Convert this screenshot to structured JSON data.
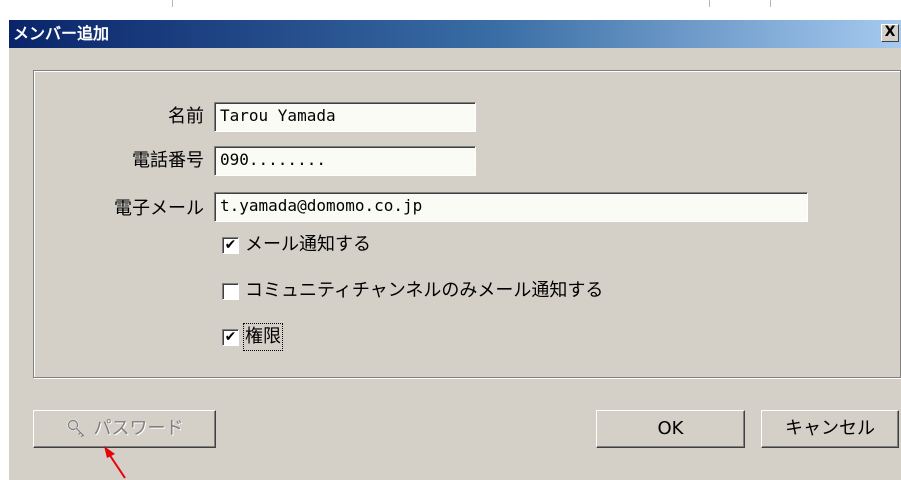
{
  "dialog": {
    "title": "メンバー追加",
    "close_label": "X"
  },
  "form": {
    "name_label": "名前",
    "name_value": "Tarou Yamada",
    "phone_label": "電話番号",
    "phone_value": "090........",
    "email_label": "電子メール",
    "email_value": "t.yamada@domomo.co.jp"
  },
  "options": [
    {
      "label": "メール通知する",
      "checked": true
    },
    {
      "label": "コミュニティチャンネルのみメール通知する",
      "checked": false
    },
    {
      "label": "権限",
      "checked": true
    }
  ],
  "buttons": {
    "password_label": "パスワード",
    "password_enabled": false,
    "ok_label": "OK",
    "cancel_label": "キャンセル"
  },
  "icons": {
    "password_button": "key-icon",
    "annotation": "red-arrow"
  },
  "colors": {
    "title_gradient_start": "#0a246a",
    "title_gradient_end": "#a6caf0",
    "dialog_face": "#d4d0c8",
    "annotation_arrow": "#e8000b"
  }
}
